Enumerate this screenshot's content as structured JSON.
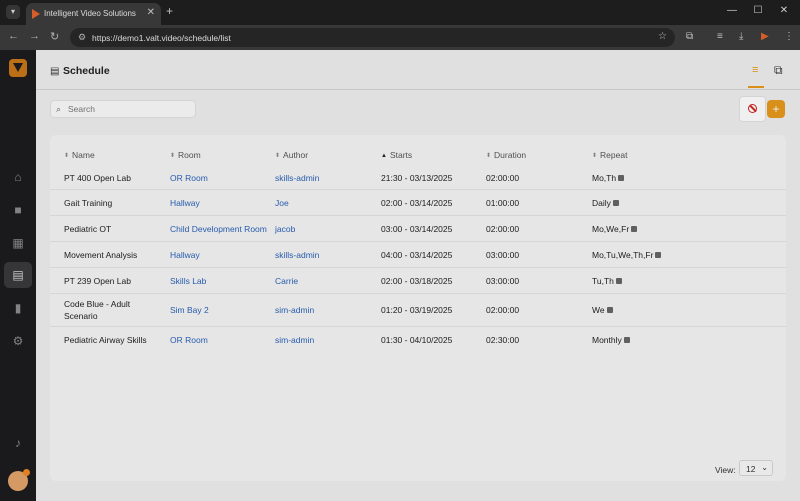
{
  "browser": {
    "tab_title": "Intelligent Video Solutions",
    "url": "https://demo1.valt.video/schedule/list"
  },
  "page": {
    "title": "Schedule"
  },
  "search": {
    "placeholder": "Search"
  },
  "table": {
    "columns": [
      "Name",
      "Room",
      "Author",
      "Starts",
      "Duration",
      "Repeat"
    ],
    "sorted_column": "Starts",
    "rows": [
      {
        "name": "PT 400 Open Lab",
        "room": "OR Room",
        "author": "skills-admin",
        "starts": "21:30 - 03/13/2025",
        "duration": "02:00:00",
        "repeat": "Mo,Th"
      },
      {
        "name": "Gait Training",
        "room": "Hallway",
        "author": "Joe",
        "starts": "02:00 - 03/14/2025",
        "duration": "01:00:00",
        "repeat": "Daily"
      },
      {
        "name": "Pediatric OT",
        "room": "Child Development Room",
        "author": "jacob",
        "starts": "03:00 - 03/14/2025",
        "duration": "02:00:00",
        "repeat": "Mo,We,Fr"
      },
      {
        "name": "Movement Analysis",
        "room": "Hallway",
        "author": "skills-admin",
        "starts": "04:00 - 03/14/2025",
        "duration": "03:00:00",
        "repeat": "Mo,Tu,We,Th,Fr"
      },
      {
        "name": "PT 239 Open Lab",
        "room": "Skills Lab",
        "author": "Carrie",
        "starts": "02:00 - 03/18/2025",
        "duration": "03:00:00",
        "repeat": "Tu,Th"
      },
      {
        "name": "Code Blue - Adult Scenario",
        "room": "Sim Bay 2",
        "author": "sim-admin",
        "starts": "01:20 - 03/19/2025",
        "duration": "02:00:00",
        "repeat": "We"
      },
      {
        "name": "Pediatric Airway Skills",
        "room": "OR Room",
        "author": "sim-admin",
        "starts": "01:30 - 04/10/2025",
        "duration": "02:30:00",
        "repeat": "Monthly"
      }
    ]
  },
  "pagination": {
    "view_label": "View:",
    "page_size": "12"
  },
  "colors": {
    "accent": "#e69a1c",
    "link": "#2b62b8",
    "danger": "#d22525"
  }
}
